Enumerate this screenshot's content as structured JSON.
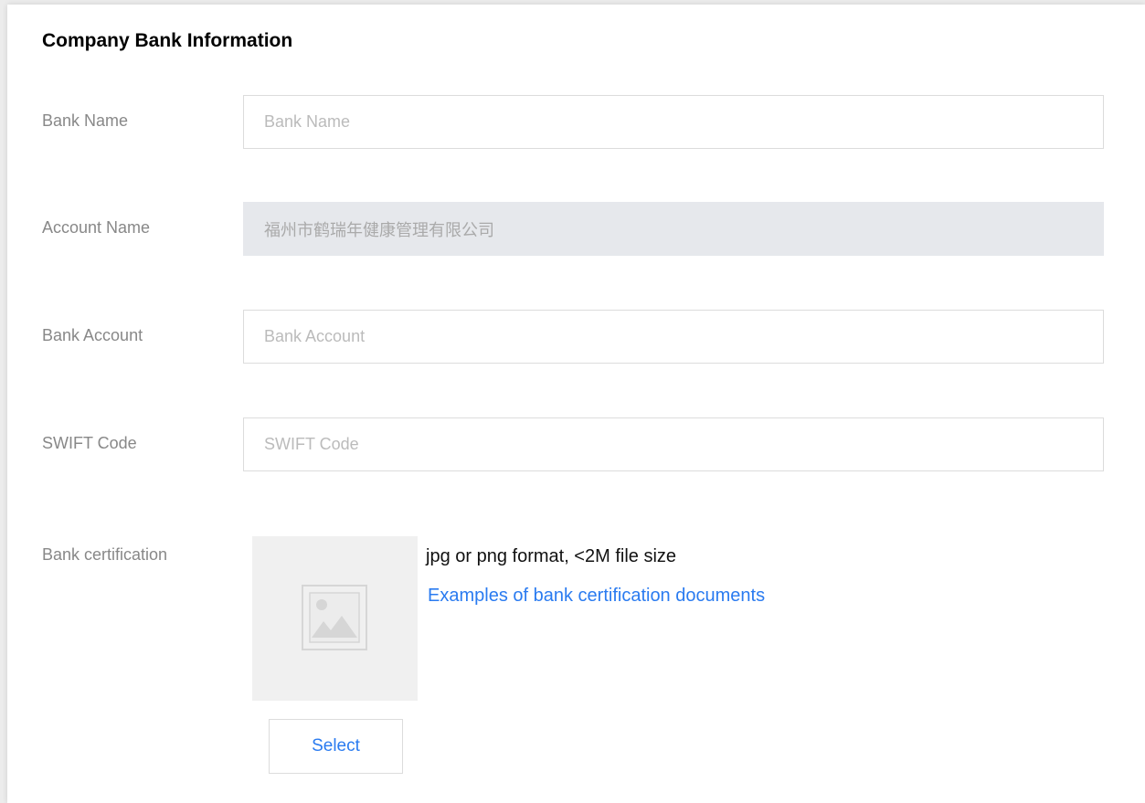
{
  "section": {
    "title": "Company Bank Information"
  },
  "fields": {
    "bank_name": {
      "label": "Bank Name",
      "placeholder": "Bank Name",
      "value": ""
    },
    "account_name": {
      "label": "Account Name",
      "value": "福州市鹤瑞年健康管理有限公司",
      "disabled": true
    },
    "bank_account": {
      "label": "Bank Account",
      "placeholder": "Bank Account",
      "value": ""
    },
    "swift_code": {
      "label": "SWIFT Code",
      "placeholder": "SWIFT Code",
      "value": ""
    }
  },
  "upload": {
    "label": "Bank certification",
    "hint": "jpg or png format, <2M file size",
    "examples_link": "Examples of bank certification documents",
    "select_label": "Select",
    "preview_icon": "image-placeholder-icon"
  },
  "colors": {
    "link": "#2a7bf0",
    "label": "#888888",
    "disabled_bg": "#e6e8ec",
    "preview_bg": "#f0f0f0"
  }
}
